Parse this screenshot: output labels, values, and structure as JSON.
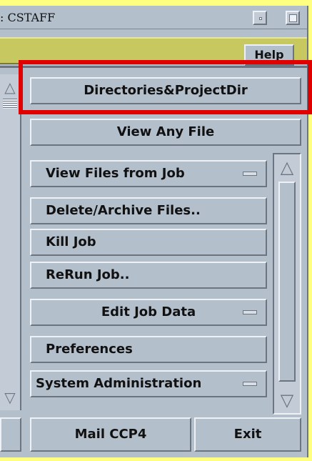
{
  "window": {
    "title": ": CSTAFF"
  },
  "menubar": {
    "help_label": "Help"
  },
  "buttons": [
    {
      "label": "Directories&ProjectDir"
    },
    {
      "label": "View Any File"
    },
    {
      "label": "View Files from Job",
      "has_menu": true
    },
    {
      "label": "Delete/Archive Files.."
    },
    {
      "label": "Kill Job"
    },
    {
      "label": "ReRun Job.."
    },
    {
      "label": "Edit Job Data",
      "has_menu": true
    },
    {
      "label": "Preferences"
    },
    {
      "label": "System Administration",
      "has_menu": true
    }
  ],
  "footer": {
    "mail_label": "Mail CCP4",
    "exit_label": "Exit"
  },
  "colors": {
    "desktop": "#ffff80",
    "menubar": "#c8c860",
    "panel": "#b4bfcc",
    "highlight": "#e00000"
  }
}
